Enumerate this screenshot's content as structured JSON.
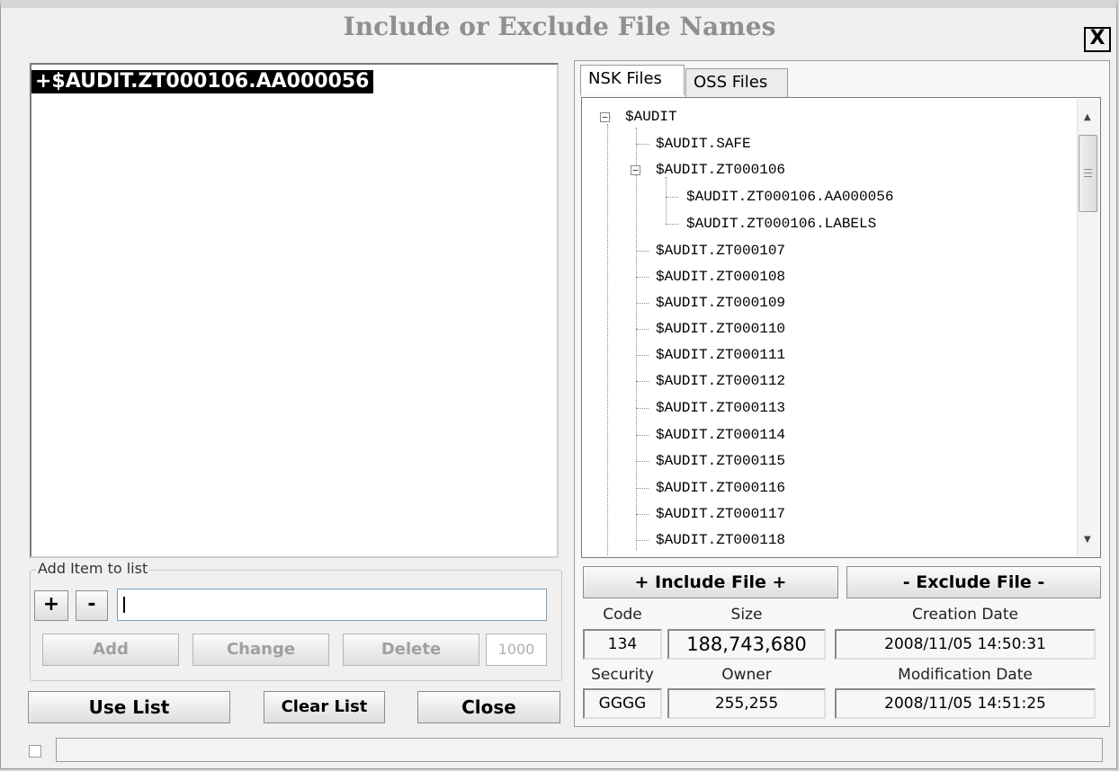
{
  "window": {
    "title": "Include or Exclude File Names",
    "close_label": "X"
  },
  "list": {
    "items": [
      "+$AUDIT.ZT000106.AA000056"
    ]
  },
  "add_item": {
    "group_label": "Add Item to list",
    "plus_label": "+",
    "minus_label": "-",
    "input_value": "",
    "add_label": "Add",
    "change_label": "Change",
    "delete_label": "Delete",
    "count": "1000"
  },
  "bottom_buttons": {
    "use_list": "Use List",
    "clear_list": "Clear List",
    "close": "Close"
  },
  "tabs": [
    {
      "label": "NSK Files",
      "active": true
    },
    {
      "label": "OSS Files",
      "active": false
    }
  ],
  "tree": {
    "root": "$AUDIT",
    "n1": "$AUDIT.SAFE",
    "n2": "$AUDIT.ZT000106",
    "n2a": "$AUDIT.ZT000106.AA000056",
    "n2b": "$AUDIT.ZT000106.LABELS",
    "n3": "$AUDIT.ZT000107",
    "n4": "$AUDIT.ZT000108",
    "n5": "$AUDIT.ZT000109",
    "n6": "$AUDIT.ZT000110",
    "n7": "$AUDIT.ZT000111",
    "n8": "$AUDIT.ZT000112",
    "n9": "$AUDIT.ZT000113",
    "n10": "$AUDIT.ZT000114",
    "n11": "$AUDIT.ZT000115",
    "n12": "$AUDIT.ZT000116",
    "n13": "$AUDIT.ZT000117",
    "n14": "$AUDIT.ZT000118"
  },
  "file_actions": {
    "include": "+ Include File +",
    "exclude": "- Exclude File -"
  },
  "info": {
    "code_label": "Code",
    "code": "134",
    "size_label": "Size",
    "size": "188,743,680",
    "creation_label": "Creation Date",
    "creation": "2008/11/05 14:50:31",
    "security_label": "Security",
    "security": "GGGG",
    "owner_label": "Owner",
    "owner": "255,255",
    "modification_label": "Modification Date",
    "modification": "2008/11/05 14:51:25"
  },
  "status": {
    "text": ""
  }
}
